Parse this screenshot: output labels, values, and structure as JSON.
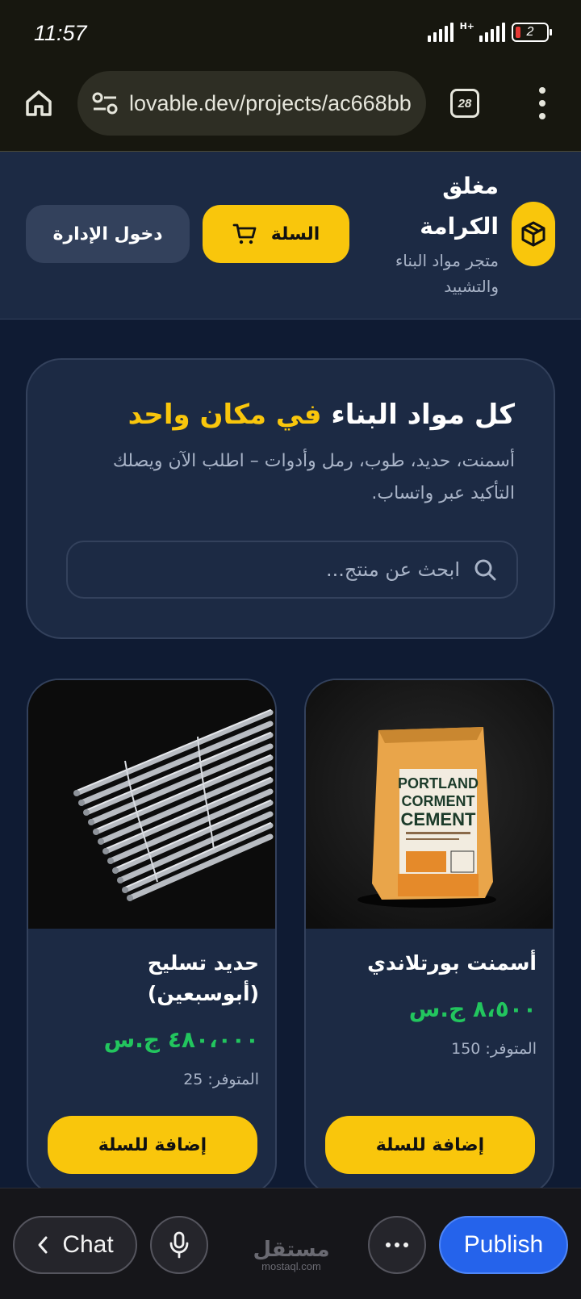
{
  "status_bar": {
    "time": "11:57",
    "network": "H+",
    "battery": "2"
  },
  "browser": {
    "url": "lovable.dev/projects/ac668bb",
    "tab_count": "28"
  },
  "site": {
    "brand_name_line1": "مغلق",
    "brand_name_line2": "الكرامة",
    "brand_sub_line1": "متجر مواد البناء",
    "brand_sub_line2": "والتشييد",
    "cart_label": "السلة",
    "admin_label": "دخول الإدارة",
    "accent_color": "#f9c60c",
    "price_color": "#22c55e"
  },
  "hero": {
    "title_main": "كل مواد البناء ",
    "title_accent": "في مكان واحد",
    "description": "أسمنت، حديد، طوب، رمل وأدوات – اطلب الآن ويصلك التأكيد عبر واتساب.",
    "search_placeholder": "ابحث عن منتج..."
  },
  "products": [
    {
      "name": "أسمنت بورتلاندي",
      "price": "٨،٥٠٠ ج.س",
      "stock": "المتوفر: 150",
      "add_label": "إضافة للسلة",
      "bag_line1": "PORTLAND",
      "bag_line2": "CORMENT",
      "bag_line3": "CEMENT"
    },
    {
      "name": "حديد تسليح (أبوسبعين)",
      "price": "٤٨٠،٠٠٠ ج.س",
      "stock": "المتوفر: 25",
      "add_label": "إضافة للسلة"
    }
  ],
  "bottom_bar": {
    "chat_label": "Chat",
    "publish_label": "Publish",
    "watermark_ar": "مستقل",
    "watermark_en": "mostaql.com"
  }
}
